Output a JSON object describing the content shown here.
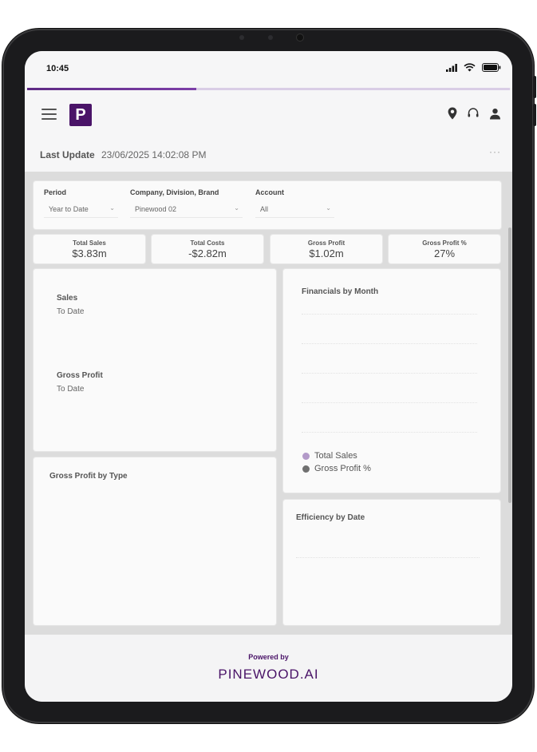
{
  "status": {
    "time": "10:45"
  },
  "header": {
    "logo_letter": "P"
  },
  "last_update": {
    "label": "Last Update",
    "value": "23/06/2025 14:02:08 PM",
    "more": "···"
  },
  "filters": {
    "period": {
      "label": "Period",
      "value": "Year to Date"
    },
    "company": {
      "label": "Company, Division, Brand",
      "value": "Pinewood 02"
    },
    "account": {
      "label": "Account",
      "value": "All"
    }
  },
  "kpis": [
    {
      "label": "Total Sales",
      "value": "$3.83m"
    },
    {
      "label": "Total Costs",
      "value": "-$2.82m"
    },
    {
      "label": "Gross Profit",
      "value": "$1.02m"
    },
    {
      "label": "Gross Profit %",
      "value": "27%"
    }
  ],
  "sales_card": {
    "sales_title": "Sales",
    "sales_sub": "To Date",
    "gp_title": "Gross Profit",
    "gp_sub": "To Date"
  },
  "financials": {
    "title": "Financials by Month",
    "legend": [
      {
        "label": "Total Sales",
        "color": "#b39ac9"
      },
      {
        "label": "Gross Profit %",
        "color": "#707070"
      }
    ]
  },
  "gp_by_type": {
    "title": "Gross Profit by Type"
  },
  "efficiency": {
    "title": "Efficiency by Date"
  },
  "footer": {
    "powered": "Powered by",
    "brand": "PINEWOOD.AI"
  },
  "colors": {
    "brand": "#4a1468",
    "accent": "#7d3fa8"
  },
  "progress": 0.35
}
